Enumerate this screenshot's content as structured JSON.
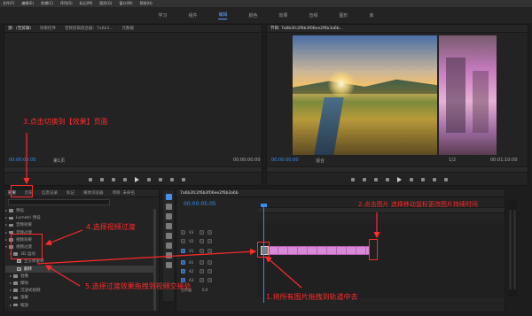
{
  "window": {
    "menu": [
      "文件(F)",
      "编辑(E)",
      "剪辑(C)",
      "序列(S)",
      "标记(M)",
      "图形(G)",
      "窗口(W)",
      "帮助(H)"
    ],
    "workspaces": [
      "学习",
      "组件",
      "编辑",
      "颜色",
      "效果",
      "音频",
      "图形",
      "库"
    ],
    "active_workspace": "编辑"
  },
  "source_panel": {
    "tabs": [
      "源：(无剪辑)",
      "效果控件",
      "音频剪辑混合器：7a6b3...",
      "元数据"
    ],
    "timecode_left": "00:00:00:00",
    "page_label": "第1页",
    "timecode_right": "00:00:00:00"
  },
  "program_panel": {
    "tab": "节目: 7a6b3fc2f6b3f06ee2f6b3a6b...",
    "timecode_left": "00:00:00:00",
    "fit": "适合",
    "ratio": "1/2",
    "timecode_right": "00:01:10:00"
  },
  "effects_panel": {
    "tabs": [
      "效果",
      "历史",
      "信息记录",
      "标记",
      "媒体浏览器",
      "项目: 未命名"
    ],
    "items": [
      {
        "label": "预设",
        "type": "folder",
        "expanded": false
      },
      {
        "label": "Lumetri 预设",
        "type": "folder",
        "expanded": false
      },
      {
        "label": "音频效果",
        "type": "folder",
        "expanded": false
      },
      {
        "label": "音频过渡",
        "type": "folder",
        "expanded": false
      },
      {
        "label": "视频效果",
        "type": "folder",
        "expanded": false
      },
      {
        "label": "视频过渡",
        "type": "folder",
        "expanded": true
      },
      {
        "label": "3D 运动",
        "type": "folder",
        "expanded": true
      },
      {
        "label": "立方体旋转",
        "type": "effect",
        "expanded": false
      },
      {
        "label": "翻转",
        "type": "effect",
        "expanded": false,
        "selected": true
      },
      {
        "label": "划像",
        "type": "folder",
        "expanded": false
      },
      {
        "label": "擦除",
        "type": "folder",
        "expanded": false
      },
      {
        "label": "沉浸式视频",
        "type": "folder",
        "expanded": false
      },
      {
        "label": "溶解",
        "type": "folder",
        "expanded": false
      },
      {
        "label": "缩放",
        "type": "folder",
        "expanded": false
      }
    ]
  },
  "timeline": {
    "tab": "7a6b3fc2f6b3f06ee2f6b3a6b",
    "timecode": "00:00:05:05",
    "tracks": [
      {
        "name": "V3",
        "kind": "video"
      },
      {
        "name": "V2",
        "kind": "video"
      },
      {
        "name": "V1",
        "kind": "video"
      },
      {
        "name": "A1",
        "kind": "audio"
      },
      {
        "name": "A2",
        "kind": "audio"
      },
      {
        "name": "A3",
        "kind": "audio"
      }
    ],
    "master_label": "主声道",
    "master_value": "0.0"
  },
  "annotations": {
    "step1": "1.将所有图片拖拽到轨道中去",
    "step2": "2.点击图片 选择移动鼠标更改图片持续时间",
    "step3": "3.点击切换到【效果】页面",
    "step4": "4.选择视频过渡",
    "step5": "5.选择过渡效果拖拽到视频交接处"
  },
  "colors": {
    "annotation_red": "#ff2a2a",
    "timecode_blue": "#3b8cf0",
    "clip_pink": "#d88ad6",
    "ui_bg": "#1d1d1d"
  }
}
